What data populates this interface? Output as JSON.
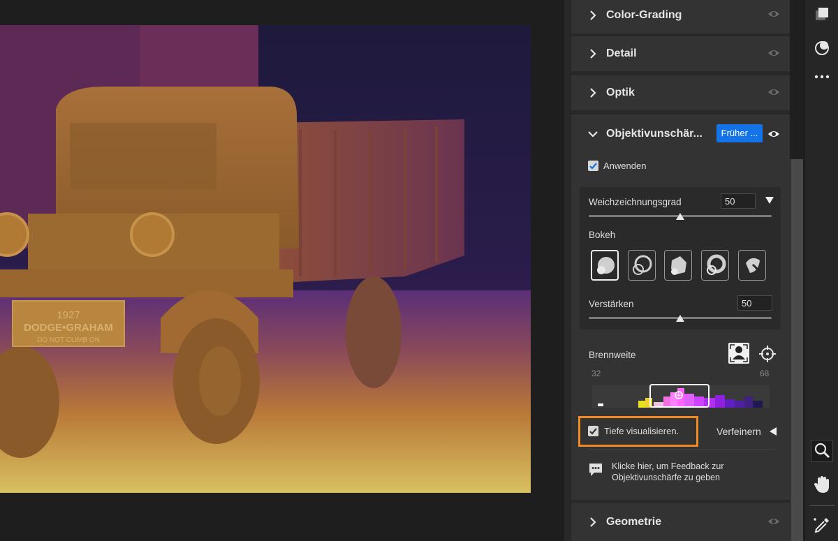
{
  "sections": {
    "color_grading": {
      "title": "Color-Grading"
    },
    "detail": {
      "title": "Detail"
    },
    "optik": {
      "title": "Optik"
    },
    "lens_blur": {
      "title": "Objektivunschär...",
      "preset_button": "Früher ...",
      "apply_label": "Anwenden",
      "apply_checked": true,
      "blur_amount_label": "Weichzeichnungsgrad",
      "blur_amount_value": "50",
      "blur_amount_level": 0.5,
      "bokeh_label": "Bokeh",
      "bokeh_shapes": [
        "circle",
        "bubble",
        "blade",
        "ring",
        "cat-eye"
      ],
      "boost_label": "Verstärken",
      "boost_value": "50",
      "boost_level": 0.5,
      "focal_range_label": "Brennweite",
      "focal_range_min": "32",
      "focal_range_max": "68",
      "visualize_depth_label": "Tiefe visualisieren.",
      "visualize_depth_checked": true,
      "refine_label": "Verfeinern",
      "feedback_line1": "Klicke hier, um Feedback zur",
      "feedback_line2": "Objektivunschärfe zu geben"
    },
    "geometrie": {
      "title": "Geometrie"
    }
  },
  "colors": {
    "accent": "#1473e6",
    "highlight": "#f08a24",
    "panel": "#333333"
  },
  "photo": {
    "plate_line1": "1927",
    "plate_line2": "DODGE•GRAHAM",
    "plate_line3": "DO NOT CLIMB ON"
  },
  "tools": [
    "layers-icon",
    "mask-icon",
    "more-icon",
    "zoom-icon",
    "hand-icon",
    "eyedropper-icon"
  ]
}
